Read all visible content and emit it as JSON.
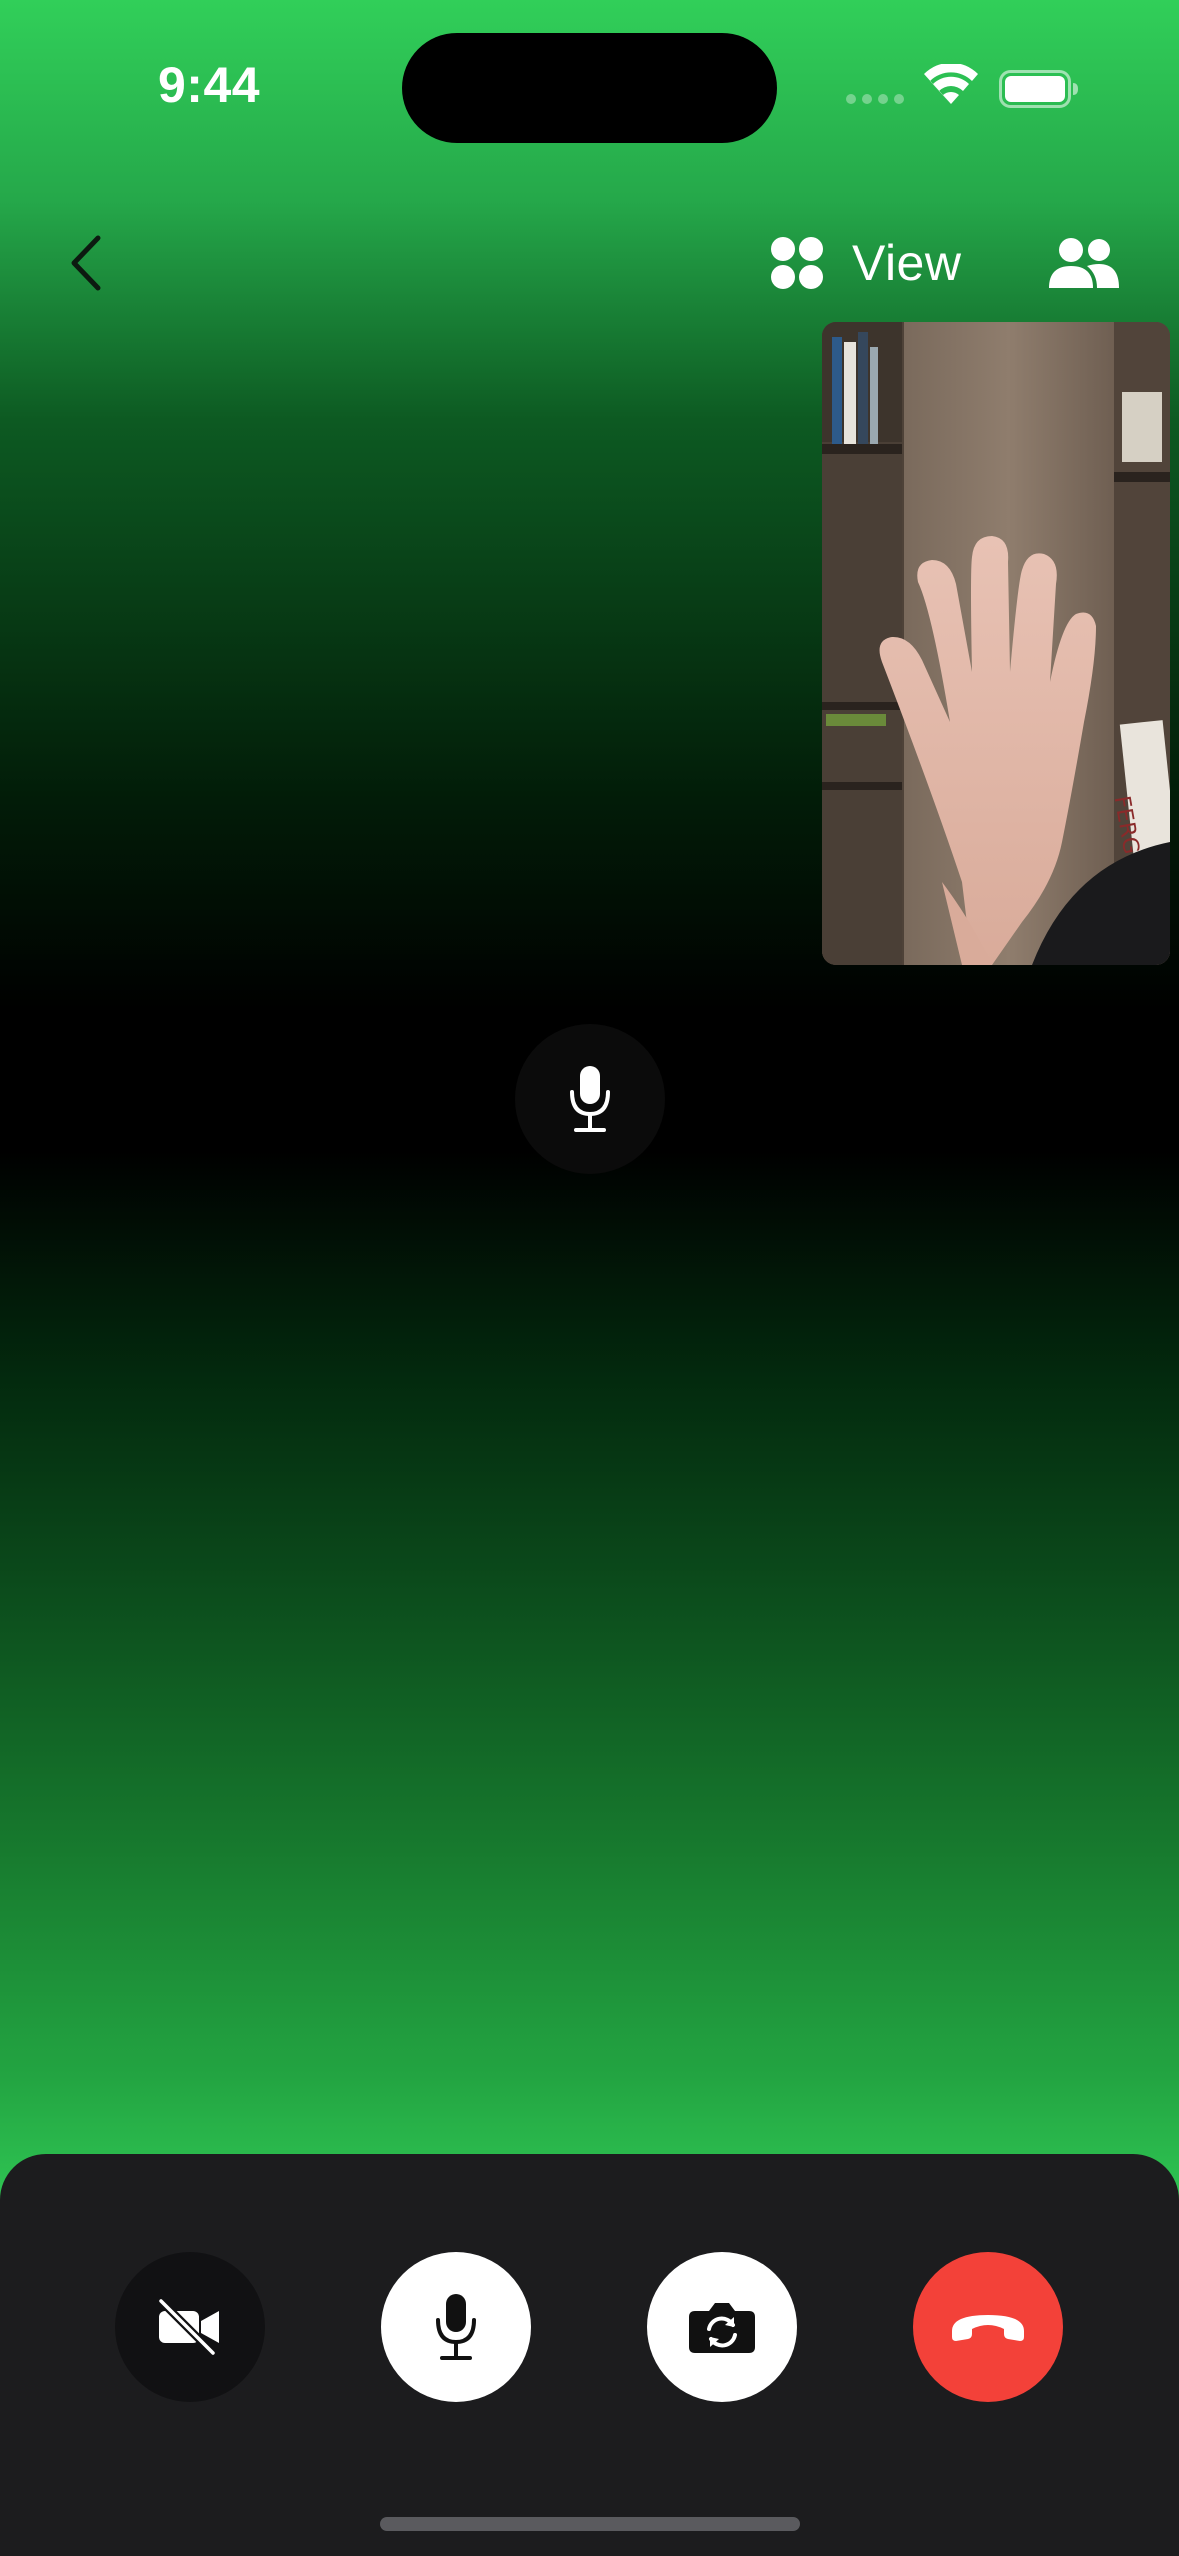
{
  "status_bar": {
    "time": "9:44",
    "icons": [
      "cellular-signal-icon",
      "wifi-icon",
      "battery-icon"
    ]
  },
  "nav": {
    "back_icon": "chevron-left-icon",
    "view_label": "View",
    "view_icon": "grid-four-dots-icon",
    "participants_icon": "people-icon"
  },
  "self_view": {
    "description_icon": "camera-preview",
    "book_spine_text": "FERGUSON"
  },
  "speaker": {
    "mic_icon": "microphone-icon"
  },
  "controls": [
    {
      "name": "camera-off",
      "icon": "video-slash-icon"
    },
    {
      "name": "microphone",
      "icon": "microphone-icon"
    },
    {
      "name": "flip-camera",
      "icon": "camera-rotate-icon"
    },
    {
      "name": "end-call",
      "icon": "phone-hangup-icon",
      "color": "#f34139"
    }
  ],
  "colors": {
    "accent_green": "#31cf59",
    "tray": "#1c1c1e",
    "end_call_red": "#f34139"
  }
}
